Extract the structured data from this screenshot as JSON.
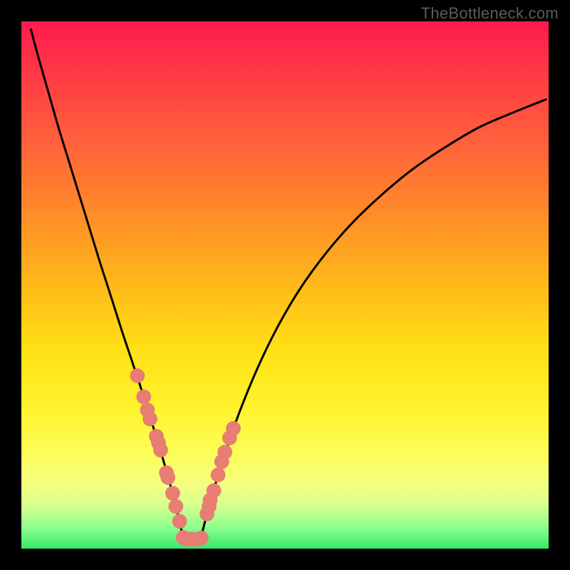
{
  "watermark": "TheBottleneck.com",
  "chart_data": {
    "type": "line",
    "title": "",
    "xlabel": "",
    "ylabel": "",
    "xlim": [
      0,
      1
    ],
    "ylim": [
      0,
      1
    ],
    "series": [
      {
        "name": "curve-left",
        "x": [
          0.018,
          0.03,
          0.05,
          0.07,
          0.09,
          0.11,
          0.13,
          0.15,
          0.17,
          0.19,
          0.21,
          0.225,
          0.24,
          0.255,
          0.27,
          0.28,
          0.29,
          0.3,
          0.307
        ],
        "y": [
          0.985,
          0.94,
          0.87,
          0.8,
          0.735,
          0.67,
          0.605,
          0.54,
          0.478,
          0.415,
          0.355,
          0.31,
          0.262,
          0.215,
          0.165,
          0.13,
          0.092,
          0.052,
          0.018
        ]
      },
      {
        "name": "curve-right",
        "x": [
          0.34,
          0.35,
          0.365,
          0.382,
          0.4,
          0.425,
          0.455,
          0.49,
          0.53,
          0.575,
          0.625,
          0.68,
          0.74,
          0.805,
          0.87,
          0.94,
          0.995
        ],
        "y": [
          0.018,
          0.058,
          0.112,
          0.168,
          0.222,
          0.288,
          0.358,
          0.428,
          0.495,
          0.557,
          0.615,
          0.668,
          0.718,
          0.762,
          0.8,
          0.83,
          0.852
        ]
      },
      {
        "name": "floor",
        "x": [
          0.307,
          0.34
        ],
        "y": [
          0.018,
          0.018
        ]
      }
    ],
    "scatter": {
      "name": "highlight-dots",
      "x": [
        0.22,
        0.232,
        0.239,
        0.244,
        0.256,
        0.26,
        0.264,
        0.275,
        0.278,
        0.287,
        0.293,
        0.3,
        0.307,
        0.315,
        0.323,
        0.333,
        0.341,
        0.352,
        0.356,
        0.358,
        0.365,
        0.373,
        0.38,
        0.386,
        0.395,
        0.402
      ],
      "y": [
        0.328,
        0.288,
        0.263,
        0.246,
        0.213,
        0.201,
        0.187,
        0.144,
        0.135,
        0.105,
        0.08,
        0.052,
        0.021,
        0.018,
        0.018,
        0.018,
        0.02,
        0.066,
        0.08,
        0.092,
        0.11,
        0.14,
        0.165,
        0.183,
        0.21,
        0.228
      ],
      "color": "#e77d73",
      "radius_rel": 0.014
    },
    "background_gradient": {
      "top": "#ff1a4d",
      "mid": "#ffe014",
      "bottom": "#38e66b"
    }
  }
}
